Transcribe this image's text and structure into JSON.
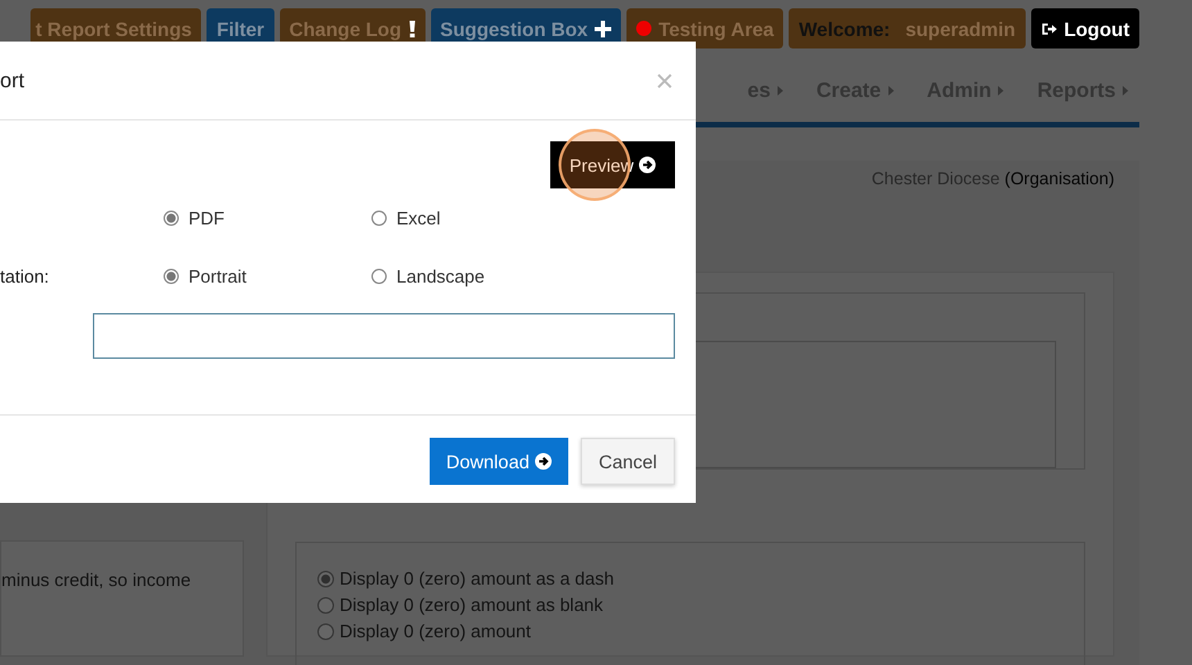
{
  "top_nav": [
    {
      "label": "t Report Settings",
      "color": "#4f3313",
      "kind": "text"
    },
    {
      "label": "Filter",
      "color": "#0d3a60",
      "kind": "text"
    },
    {
      "label": "Change Log",
      "color": "#4f3313",
      "kind": "alert"
    },
    {
      "label": "Suggestion Box",
      "color": "#0d3a60",
      "kind": "add"
    },
    {
      "label": "Testing Area",
      "color": "#4f3313",
      "kind": "status"
    },
    {
      "label": "Welcome:",
      "user": "superadmin",
      "color": "#4f3313",
      "kind": "user"
    },
    {
      "label": "Logout",
      "color": "#000000",
      "kind": "exit"
    }
  ],
  "menu": [
    {
      "label": "es"
    },
    {
      "label": "Create"
    },
    {
      "label": "Admin"
    },
    {
      "label": "Reports"
    }
  ],
  "organisation": {
    "name": "Chester Diocese",
    "type": "(Organisation)"
  },
  "left_panel_text": "minus credit, so income",
  "zero_options": [
    {
      "label": "Display 0 (zero) amount as a dash",
      "selected": true
    },
    {
      "label": "Display 0 (zero) amount as blank",
      "selected": false
    },
    {
      "label": "Display 0 (zero) amount",
      "selected": false
    }
  ],
  "modal": {
    "title": "ort",
    "preview_button": "Preview",
    "rows": [
      {
        "options": [
          {
            "label": "PDF",
            "selected": true
          },
          {
            "label": "Excel",
            "selected": false
          }
        ]
      },
      {
        "label": "tation:",
        "options": [
          {
            "label": "Portrait",
            "selected": true
          },
          {
            "label": "Landscape",
            "selected": false
          }
        ]
      }
    ],
    "download_button": "Download",
    "cancel_button": "Cancel"
  }
}
